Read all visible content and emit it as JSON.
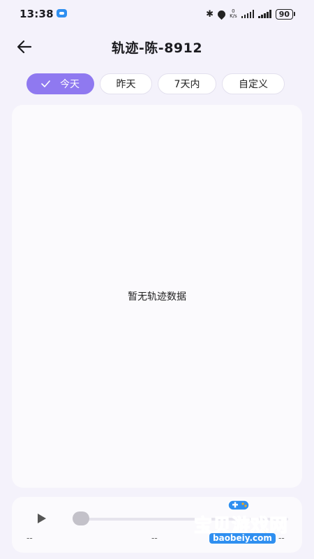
{
  "status_bar": {
    "time": "13:38",
    "speed_top": "0",
    "speed_bottom": "K/s",
    "battery": "90"
  },
  "header": {
    "title": "轨迹-陈-8912"
  },
  "tabs": [
    {
      "label": "今天",
      "active": true
    },
    {
      "label": "昨天",
      "active": false
    },
    {
      "label": "7天内",
      "active": false
    },
    {
      "label": "自定义",
      "active": false
    }
  ],
  "map": {
    "empty_text": "暂无轨迹数据"
  },
  "playback": {
    "progress": 0,
    "start_time": "--",
    "current_time": "--",
    "end_time": "--"
  },
  "watermark": {
    "text": "宝贝游戏网",
    "url": "baobeiy.com"
  },
  "colors": {
    "accent": "#8f79f0",
    "background": "#f4f2fb",
    "panel": "#fbfafd"
  }
}
